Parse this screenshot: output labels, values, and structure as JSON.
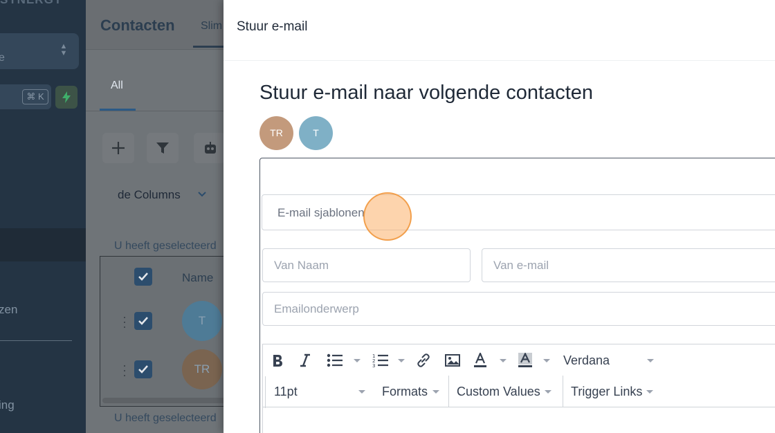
{
  "sidebar": {
    "brand": "SYNERGY",
    "location_text": "e",
    "shortcut": "⌘ K",
    "items": [
      {
        "label": "zen"
      },
      {
        "label": "ing"
      }
    ]
  },
  "main": {
    "title": "Contacten",
    "tab_label": "Slim",
    "filter_tab": "All",
    "columns_button": "de Columns",
    "selection_text_top": "U heeft geselecteerd",
    "selection_text_bottom": "U heeft geselecteerd",
    "table": {
      "column_name": "Name",
      "rows": [
        {
          "initials": "T",
          "color": "#4e7b96"
        },
        {
          "initials": "TR",
          "color": "#7a6450"
        }
      ]
    }
  },
  "drawer": {
    "header_title": "Stuur e-mail",
    "title": "Stuur e-mail naar volgende contacten",
    "recipients": [
      {
        "initials": "TR",
        "color": "#c39a7c"
      },
      {
        "initials": "T",
        "color": "#7fb0c6"
      }
    ],
    "form": {
      "template_placeholder": "E-mail sjablonen",
      "from_name_placeholder": "Van Naam",
      "from_email_placeholder": "Van e-mail",
      "subject_placeholder": "Emailonderwerp"
    },
    "editor": {
      "font_family": "Verdana",
      "font_size": "11pt",
      "formats_label": "Formats",
      "custom_values_label": "Custom Values",
      "trigger_links_label": "Trigger Links"
    }
  },
  "colors": {
    "sidebar_bg": "#243444",
    "overlay": "#6f7478",
    "accent": "#2c4d6d",
    "cursor": "#fbb069"
  }
}
